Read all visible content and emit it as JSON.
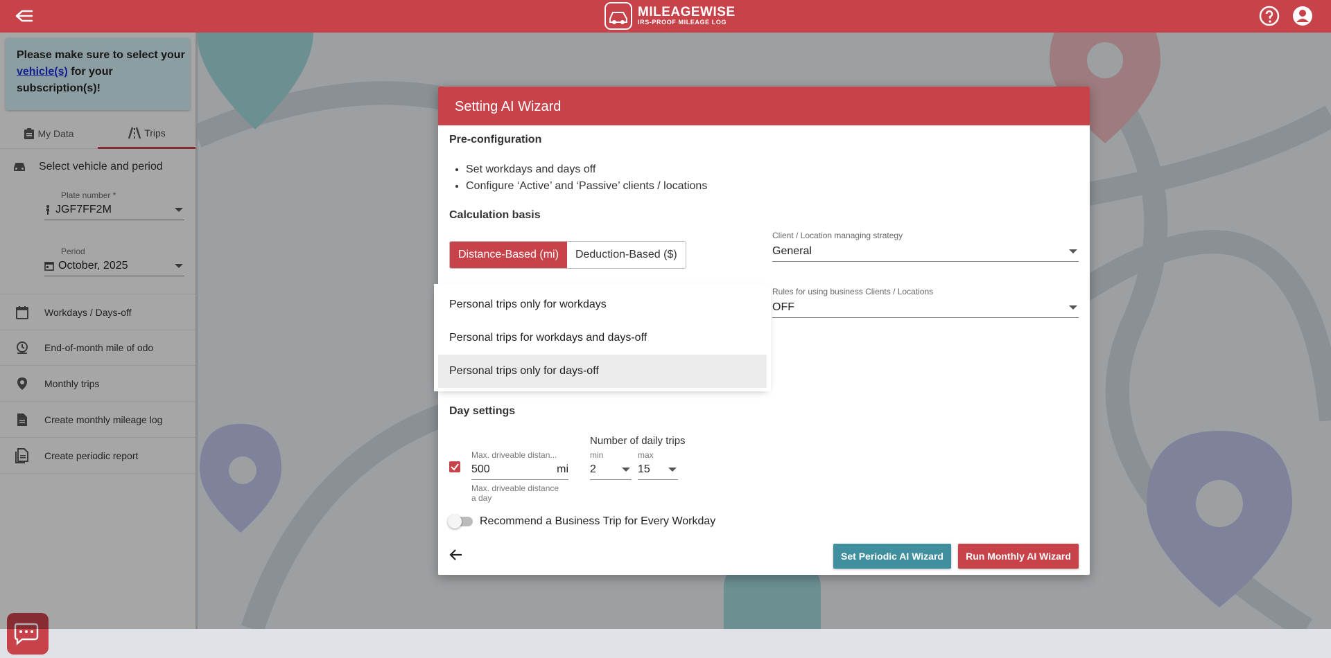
{
  "header": {
    "brand_name": "MILEAGEWISE",
    "brand_tagline": "IRS-PROOF MILEAGE LOG",
    "icons": [
      "back-arrow-icon",
      "help-icon",
      "account-icon"
    ]
  },
  "sidebar": {
    "notice": {
      "prefix": "Please make sure to select your ",
      "link": "vehicle(s)",
      "suffix": " for your subscription(s)!"
    },
    "tabs": [
      {
        "label": "My Data",
        "icon": "clipboard-icon"
      },
      {
        "label": "Trips",
        "icon": "road-icon"
      }
    ],
    "section_title": "Select vehicle and period",
    "plate": {
      "label": "Plate number *",
      "value": "JGF7FF2M"
    },
    "period": {
      "label": "Period",
      "value": "October, 2025"
    },
    "nav": [
      {
        "label": "Workdays / Days-off",
        "icon": "calendar-icon"
      },
      {
        "label": "End-of-month mile of odo",
        "icon": "odometer-icon"
      },
      {
        "label": "Monthly trips",
        "icon": "location-pin-icon"
      },
      {
        "label": "Create monthly mileage log",
        "icon": "document-icon"
      },
      {
        "label": "Create periodic report",
        "icon": "report-icon"
      }
    ]
  },
  "dialog": {
    "title": "Setting AI Wizard",
    "preconfig_heading": "Pre-configuration",
    "bullets": [
      "Set workdays and days off",
      "Configure ‘Active’ and ‘Passive’ clients / locations"
    ],
    "calc_heading": "Calculation basis",
    "calc_options": [
      "Distance-Based (mi)",
      "Deduction-Based ($)"
    ],
    "strategy": {
      "label": "Client / Location managing strategy",
      "value": "General"
    },
    "rules": {
      "label": "Rules for using business Clients / Locations",
      "value": "OFF"
    },
    "day_heading": "Day settings",
    "max_distance": {
      "label": "Max. driveable distan...",
      "value": "500",
      "unit": "mi",
      "helper": "Max. driveable distance a day"
    },
    "daily_trips": {
      "label": "Number of daily trips",
      "min_label": "min",
      "min_value": "2",
      "max_label": "max",
      "max_value": "15"
    },
    "recommend_label": "Recommend a Business Trip for Every Workday",
    "buttons": {
      "periodic": "Set Periodic AI Wizard",
      "monthly": "Run Monthly AI Wizard"
    }
  },
  "menu": {
    "options": [
      "Personal trips only for workdays",
      "Personal trips for workdays and days-off",
      "Personal trips only for days-off"
    ]
  },
  "colors": {
    "brand_red": "#c8424a",
    "teal": "#3f8f9e",
    "overlay": "rgba(0,0,0,0.32)"
  }
}
